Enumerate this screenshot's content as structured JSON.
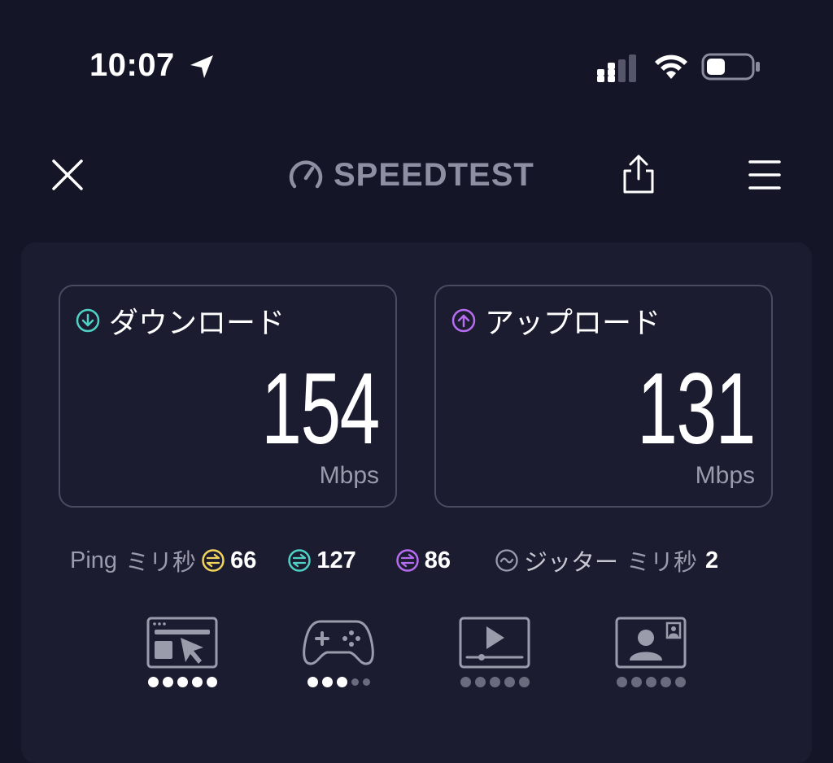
{
  "status_bar": {
    "time": "10:07"
  },
  "header": {
    "logo_text": "SPEEDTEST"
  },
  "results": {
    "download": {
      "label": "ダウンロード",
      "value": "154",
      "unit": "Mbps"
    },
    "upload": {
      "label": "アップロード",
      "value": "131",
      "unit": "Mbps"
    }
  },
  "ping": {
    "label": "Ping",
    "unit": "ミリ秒",
    "idle": "66",
    "download": "127",
    "upload": "86",
    "jitter_label": "ジッター",
    "jitter_unit": "ミリ秒",
    "jitter": "2"
  },
  "colors": {
    "download_accent": "#4fd1c5",
    "upload_accent": "#b56cf0",
    "idle_accent": "#f2d35c"
  },
  "usage_ratings": [
    {
      "icon": "web-browsing-icon",
      "filled": 5,
      "total": 5
    },
    {
      "icon": "gaming-icon",
      "filled": 3,
      "total": 5
    },
    {
      "icon": "video-streaming-icon",
      "filled": 0,
      "total": 5
    },
    {
      "icon": "video-call-icon",
      "filled": 0,
      "total": 5
    }
  ]
}
